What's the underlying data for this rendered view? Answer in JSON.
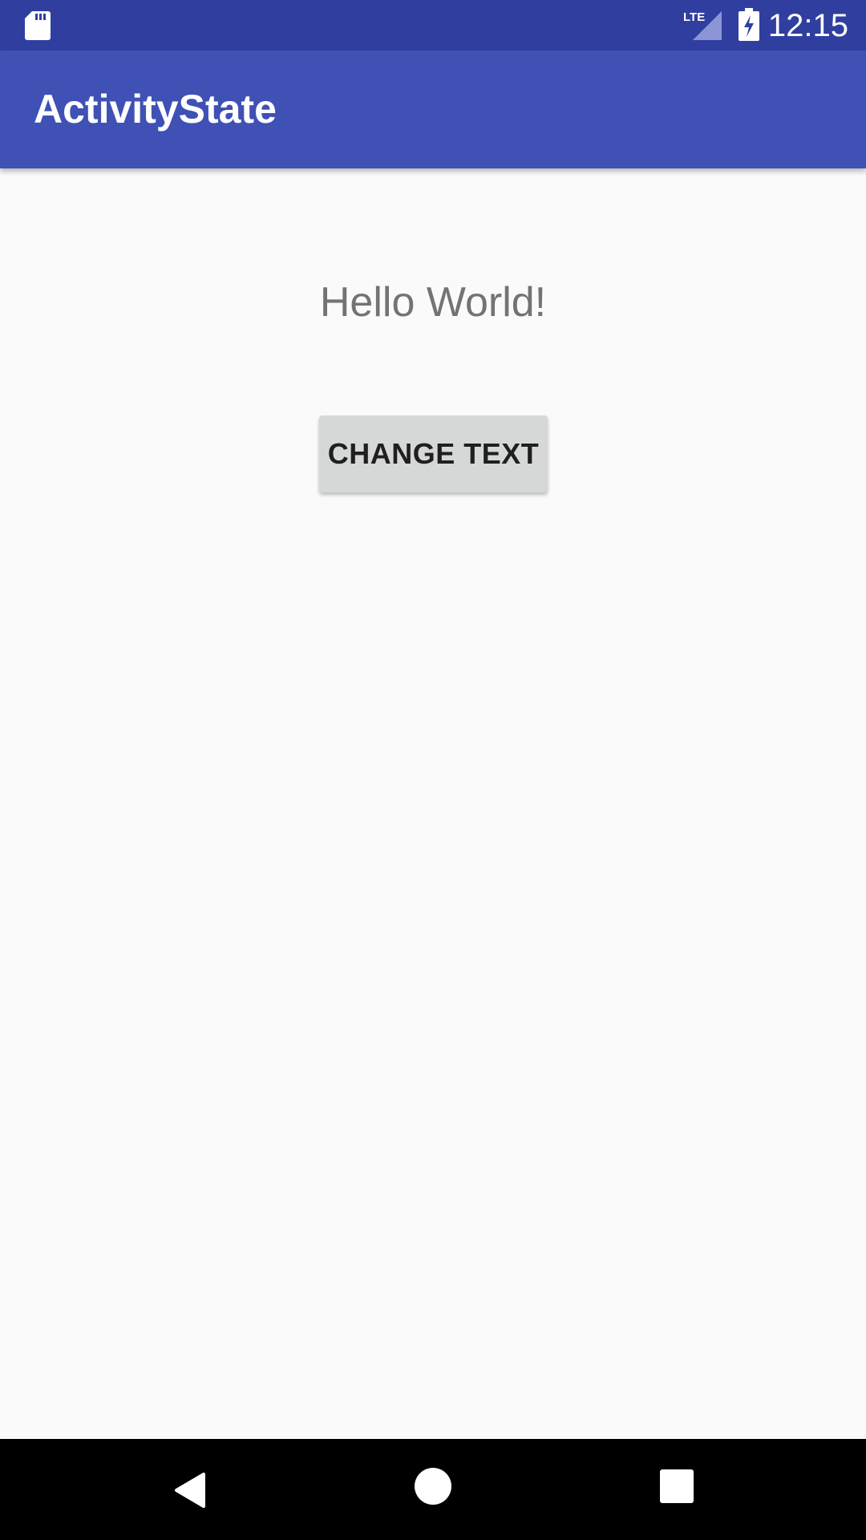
{
  "status_bar": {
    "time": "12:15",
    "network_label": "LTE",
    "icons": [
      "sd-card-icon",
      "lte-signal-icon",
      "battery-charging-icon"
    ],
    "background_color": "#303f9f"
  },
  "app_bar": {
    "title": "ActivityState",
    "background_color": "#3f51b5"
  },
  "content": {
    "hello_text": "Hello World!",
    "change_button_label": "CHANGE TEXT"
  },
  "nav_bar": {
    "buttons": [
      "back-icon",
      "home-icon",
      "recents-icon"
    ]
  }
}
